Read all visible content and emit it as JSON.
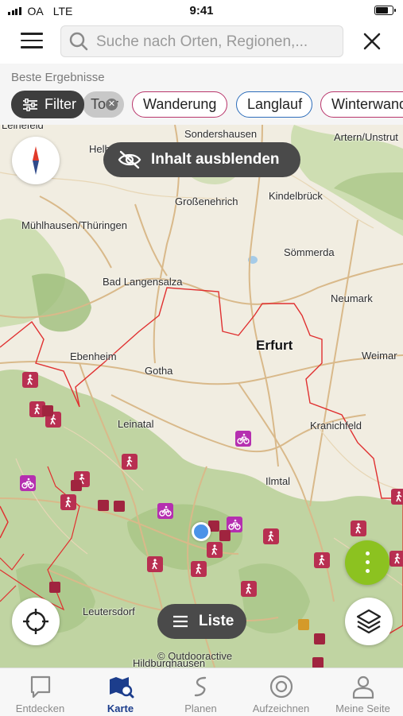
{
  "status_bar": {
    "carrier": "OA",
    "network": "LTE",
    "time": "9:41"
  },
  "search": {
    "placeholder": "Suche nach Orten, Regionen,..."
  },
  "filters": {
    "section_label": "Beste Ergebnisse",
    "filter_button": "Filter",
    "chips": [
      {
        "label": "Tour",
        "active": true
      },
      {
        "label": "Wanderung",
        "color": "#b9356b"
      },
      {
        "label": "Langlauf",
        "color": "#2d6dba"
      },
      {
        "label": "Winterwand",
        "color": "#b9356b"
      }
    ]
  },
  "map": {
    "hide_content_button": "Inhalt ausblenden",
    "list_button": "Liste",
    "attribution": "© Outdooractive",
    "places": [
      "Leinefeld",
      "Sondershausen",
      "Artern/Unstrut",
      "Helb",
      "Großenehrich",
      "Kindelbrück",
      "Mühlhausen/Thüringen",
      "Sömmerda",
      "Bad Langensalza",
      "Neumark",
      "Erfurt",
      "Ebenheim",
      "Weimar",
      "Gotha",
      "Leinatal",
      "Kranichfeld",
      "Ilmtal",
      "Leutersdorf",
      "Hildburghausen"
    ],
    "colors": {
      "hiking": "#b82f51",
      "biking": "#b52fb0",
      "boundary": "#e03030",
      "forest": "#b7cf96"
    }
  },
  "tabbar": {
    "tabs": [
      {
        "label": "Entdecken",
        "icon": "chat-bubble-icon"
      },
      {
        "label": "Karte",
        "icon": "map-icon",
        "active": true
      },
      {
        "label": "Planen",
        "icon": "route-icon"
      },
      {
        "label": "Aufzeichnen",
        "icon": "record-icon"
      },
      {
        "label": "Meine Seite",
        "icon": "user-icon"
      }
    ]
  }
}
